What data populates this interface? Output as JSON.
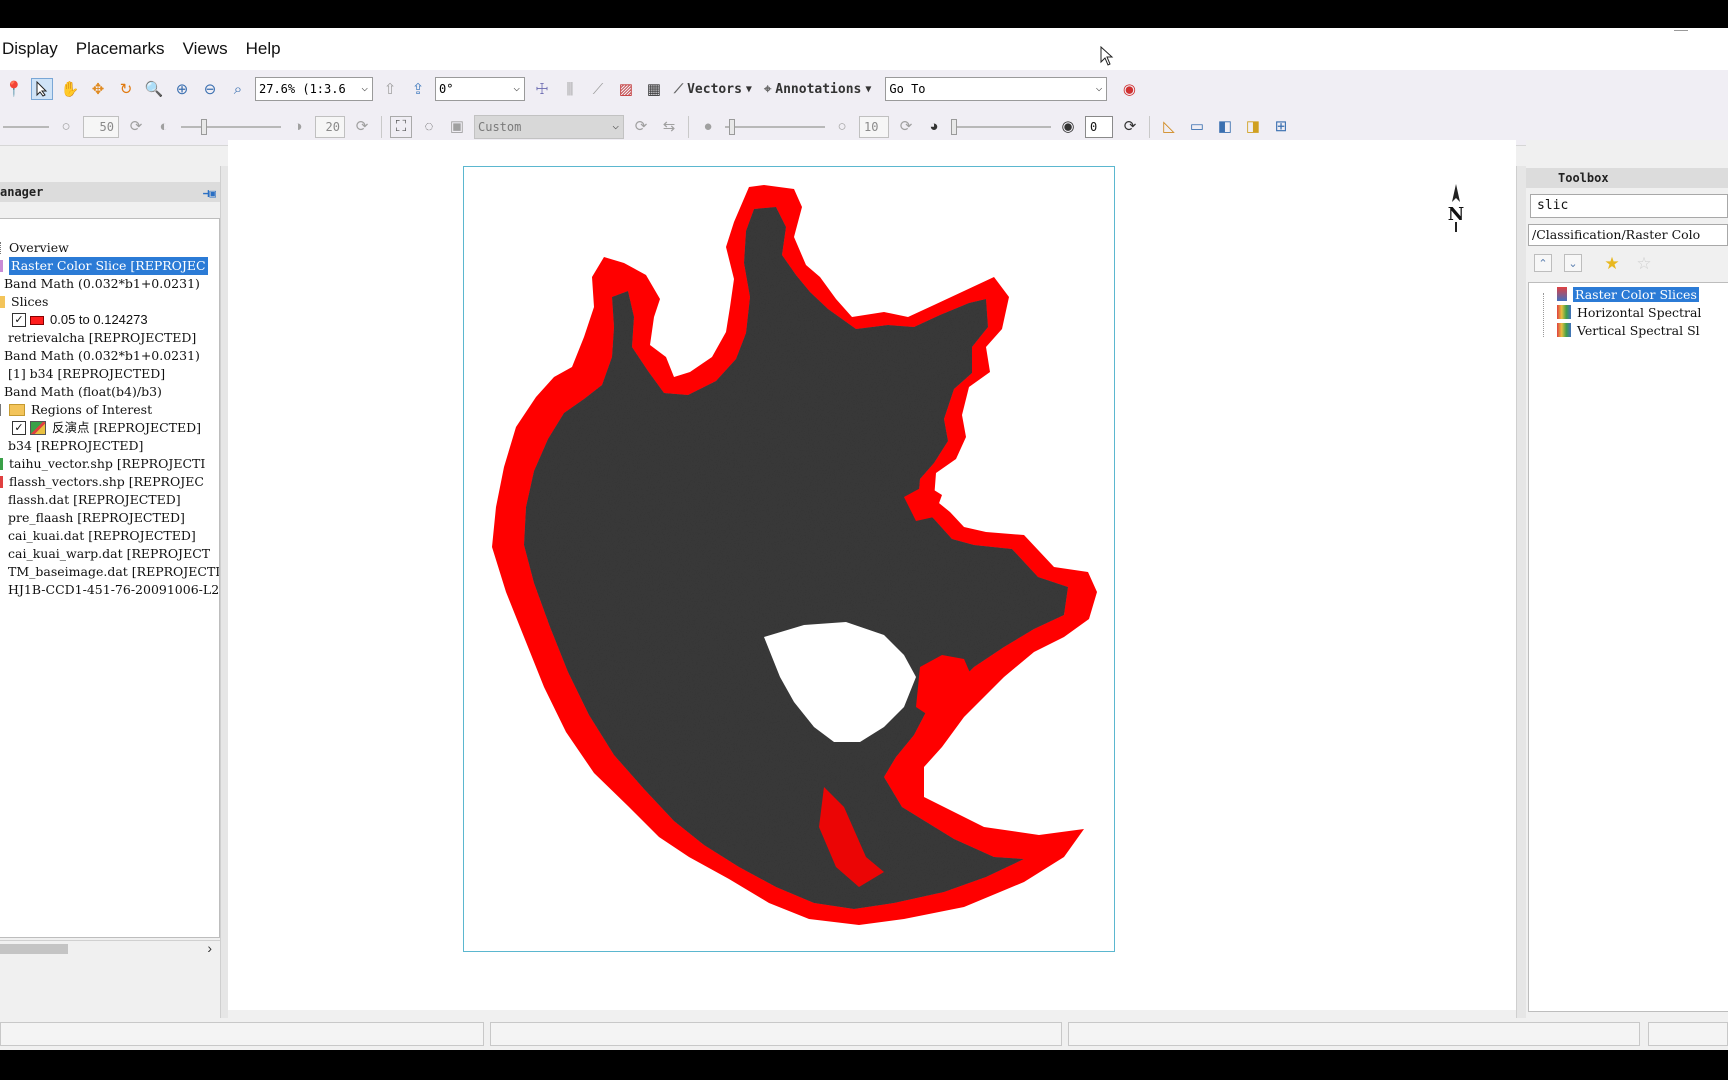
{
  "menu": {
    "items": [
      "Display",
      "Placemarks",
      "Views",
      "Help"
    ]
  },
  "toolbar1": {
    "zoom_value": "27.6% (1:3.6",
    "rotation_value": "0°",
    "vectors_label": "Vectors",
    "annotations_label": "Annotations",
    "goto_value": "Go To"
  },
  "toolbar2": {
    "brightness_value": "50",
    "contrast_value": "20",
    "stretch_value": "Custom",
    "sharpen_value": "10",
    "transparency_value": "0"
  },
  "layer_manager": {
    "title": "anager",
    "items": [
      {
        "label": "Overview"
      },
      {
        "label": "Raster Color Slice [REPROJEC",
        "selected": true
      },
      {
        "label": "Band Math (0.032*b1+0.0231)"
      },
      {
        "label": "Slices"
      },
      {
        "label": "0.05 to 0.124273",
        "checked": true
      },
      {
        "label": "retrievalcha [REPROJECTED]"
      },
      {
        "label": "Band Math (0.032*b1+0.0231)"
      },
      {
        "label": "[1] b34 [REPROJECTED]"
      },
      {
        "label": "Band Math (float(b4)/b3)"
      },
      {
        "label": "Regions of Interest"
      },
      {
        "label": "反演点 [REPROJECTED]",
        "checked": true
      },
      {
        "label": "b34 [REPROJECTED]"
      },
      {
        "label": "taihu_vector.shp [REPROJECTI"
      },
      {
        "label": "flassh_vectors.shp [REPROJEC"
      },
      {
        "label": "flassh.dat [REPROJECTED]"
      },
      {
        "label": "pre_flaash [REPROJECTED]"
      },
      {
        "label": "cai_kuai.dat [REPROJECTED]"
      },
      {
        "label": "cai_kuai_warp.dat [REPROJECT"
      },
      {
        "label": "TM_baseimage.dat [REPROJECTI"
      },
      {
        "label": "HJ1B-CCD1-451-76-20091006-L2"
      }
    ]
  },
  "view": {
    "north_label": "N",
    "colors": {
      "slice": "#ff0000",
      "water": "#3a3a3a",
      "frame": "#5bb7cf"
    }
  },
  "toolbox": {
    "title": "Toolbox",
    "search_value": "slic",
    "path_value": "/Classification/Raster Colo",
    "tools": [
      {
        "label": "Raster Color Slices",
        "selected": true
      },
      {
        "label": "Horizontal Spectral"
      },
      {
        "label": "Vertical Spectral Sl"
      }
    ]
  }
}
